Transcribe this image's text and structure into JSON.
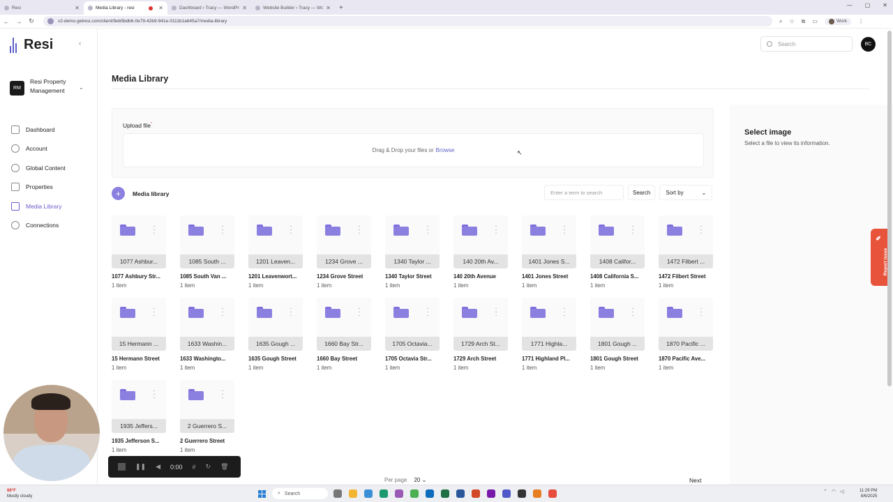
{
  "browser": {
    "tabs": [
      {
        "title": "Resi",
        "active": false
      },
      {
        "title": "Media Library - resi",
        "active": true,
        "recording": true
      },
      {
        "title": "Dashboard ‹ Tracy — WordPre",
        "active": false
      },
      {
        "title": "Website Builder ‹ Tracy — Wo",
        "active": false
      }
    ],
    "url": "v2-demo.getresi.com/client/9eb5bdb6-0e79-42b9-941e-0111b1a645a7/media-library",
    "profile": "Work"
  },
  "app": {
    "logo_text": "Resi",
    "org": {
      "initials": "RM",
      "name": "Resi Property Management"
    },
    "menu": [
      {
        "label": "Dashboard",
        "icon": "dashboard-icon",
        "active": false
      },
      {
        "label": "Account",
        "icon": "gear-icon",
        "active": false
      },
      {
        "label": "Global Content",
        "icon": "globe-icon",
        "active": false
      },
      {
        "label": "Properties",
        "icon": "building-icon",
        "active": false
      },
      {
        "label": "Media Library",
        "icon": "image-icon",
        "active": true
      },
      {
        "label": "Connections",
        "icon": "connection-icon",
        "active": false
      }
    ],
    "search_placeholder": "Search",
    "user_initials": "BC"
  },
  "page": {
    "title": "Media Library",
    "upload_label": "Upload file",
    "upload_required": "*",
    "dropzone_text": "Drag & Drop your files or",
    "dropzone_link": "Browse",
    "library_title": "Media library",
    "filter_placeholder": "Enter a term to search",
    "search_button": "Search",
    "sort_label": "Sort by",
    "per_page_label": "Per page",
    "per_page_value": "20",
    "next_label": "Next",
    "report_issue": "Report issue",
    "side_panel": {
      "title": "Select image",
      "subtitle": "Select a file to view its information."
    }
  },
  "folders": [
    {
      "tile": "1077 Ashbur...",
      "name": "1077 Ashbury Str...",
      "count": "1 item"
    },
    {
      "tile": "1085 South ...",
      "name": "1085 South Van ...",
      "count": "1 item"
    },
    {
      "tile": "1201 Leaven...",
      "name": "1201 Leavenwort...",
      "count": "1 item"
    },
    {
      "tile": "1234 Grove ...",
      "name": "1234 Grove Street",
      "count": "1 item"
    },
    {
      "tile": "1340 Taylor ...",
      "name": "1340 Taylor Street",
      "count": "1 item"
    },
    {
      "tile": "140 20th Av...",
      "name": "140 20th Avenue",
      "count": "1 item"
    },
    {
      "tile": "1401 Jones S...",
      "name": "1401 Jones Street",
      "count": "1 item"
    },
    {
      "tile": "1408 Califor...",
      "name": "1408 California S...",
      "count": "1 item"
    },
    {
      "tile": "1472 Filbert ...",
      "name": "1472 Filbert Street",
      "count": "1 item"
    },
    {
      "tile": "15 Hermann ...",
      "name": "15 Hermann Street",
      "count": "1 item"
    },
    {
      "tile": "1633 Washin...",
      "name": "1633 Washingto...",
      "count": "1 item"
    },
    {
      "tile": "1635 Gough ...",
      "name": "1635 Gough Street",
      "count": "1 item"
    },
    {
      "tile": "1660 Bay Str...",
      "name": "1660 Bay Street",
      "count": "1 item"
    },
    {
      "tile": "1705 Octavia...",
      "name": "1705 Octavia Str...",
      "count": "1 item"
    },
    {
      "tile": "1729 Arch St...",
      "name": "1729 Arch Street",
      "count": "1 item"
    },
    {
      "tile": "1771 Highla...",
      "name": "1771 Highland Pl...",
      "count": "1 item"
    },
    {
      "tile": "1801 Gough ...",
      "name": "1801 Gough Street",
      "count": "1 item"
    },
    {
      "tile": "1870 Pacific ...",
      "name": "1870 Pacific Ave...",
      "count": "1 item"
    },
    {
      "tile": "1935 Jeffers...",
      "name": "1935 Jefferson S...",
      "count": "1 item"
    },
    {
      "tile": "2 Guerrero S...",
      "name": "2 Guerrero Street",
      "count": "1 item"
    }
  ],
  "recorder": {
    "time": "0:00"
  },
  "taskbar": {
    "weather_temp": "88°F",
    "weather_desc": "Mostly cloudy",
    "search_label": "Search",
    "time": "11:29 PM",
    "date": "8/6/2025"
  },
  "colors": {
    "accent": "#6a5acd",
    "folder": "#8b7fe0",
    "report": "#e8533b"
  }
}
